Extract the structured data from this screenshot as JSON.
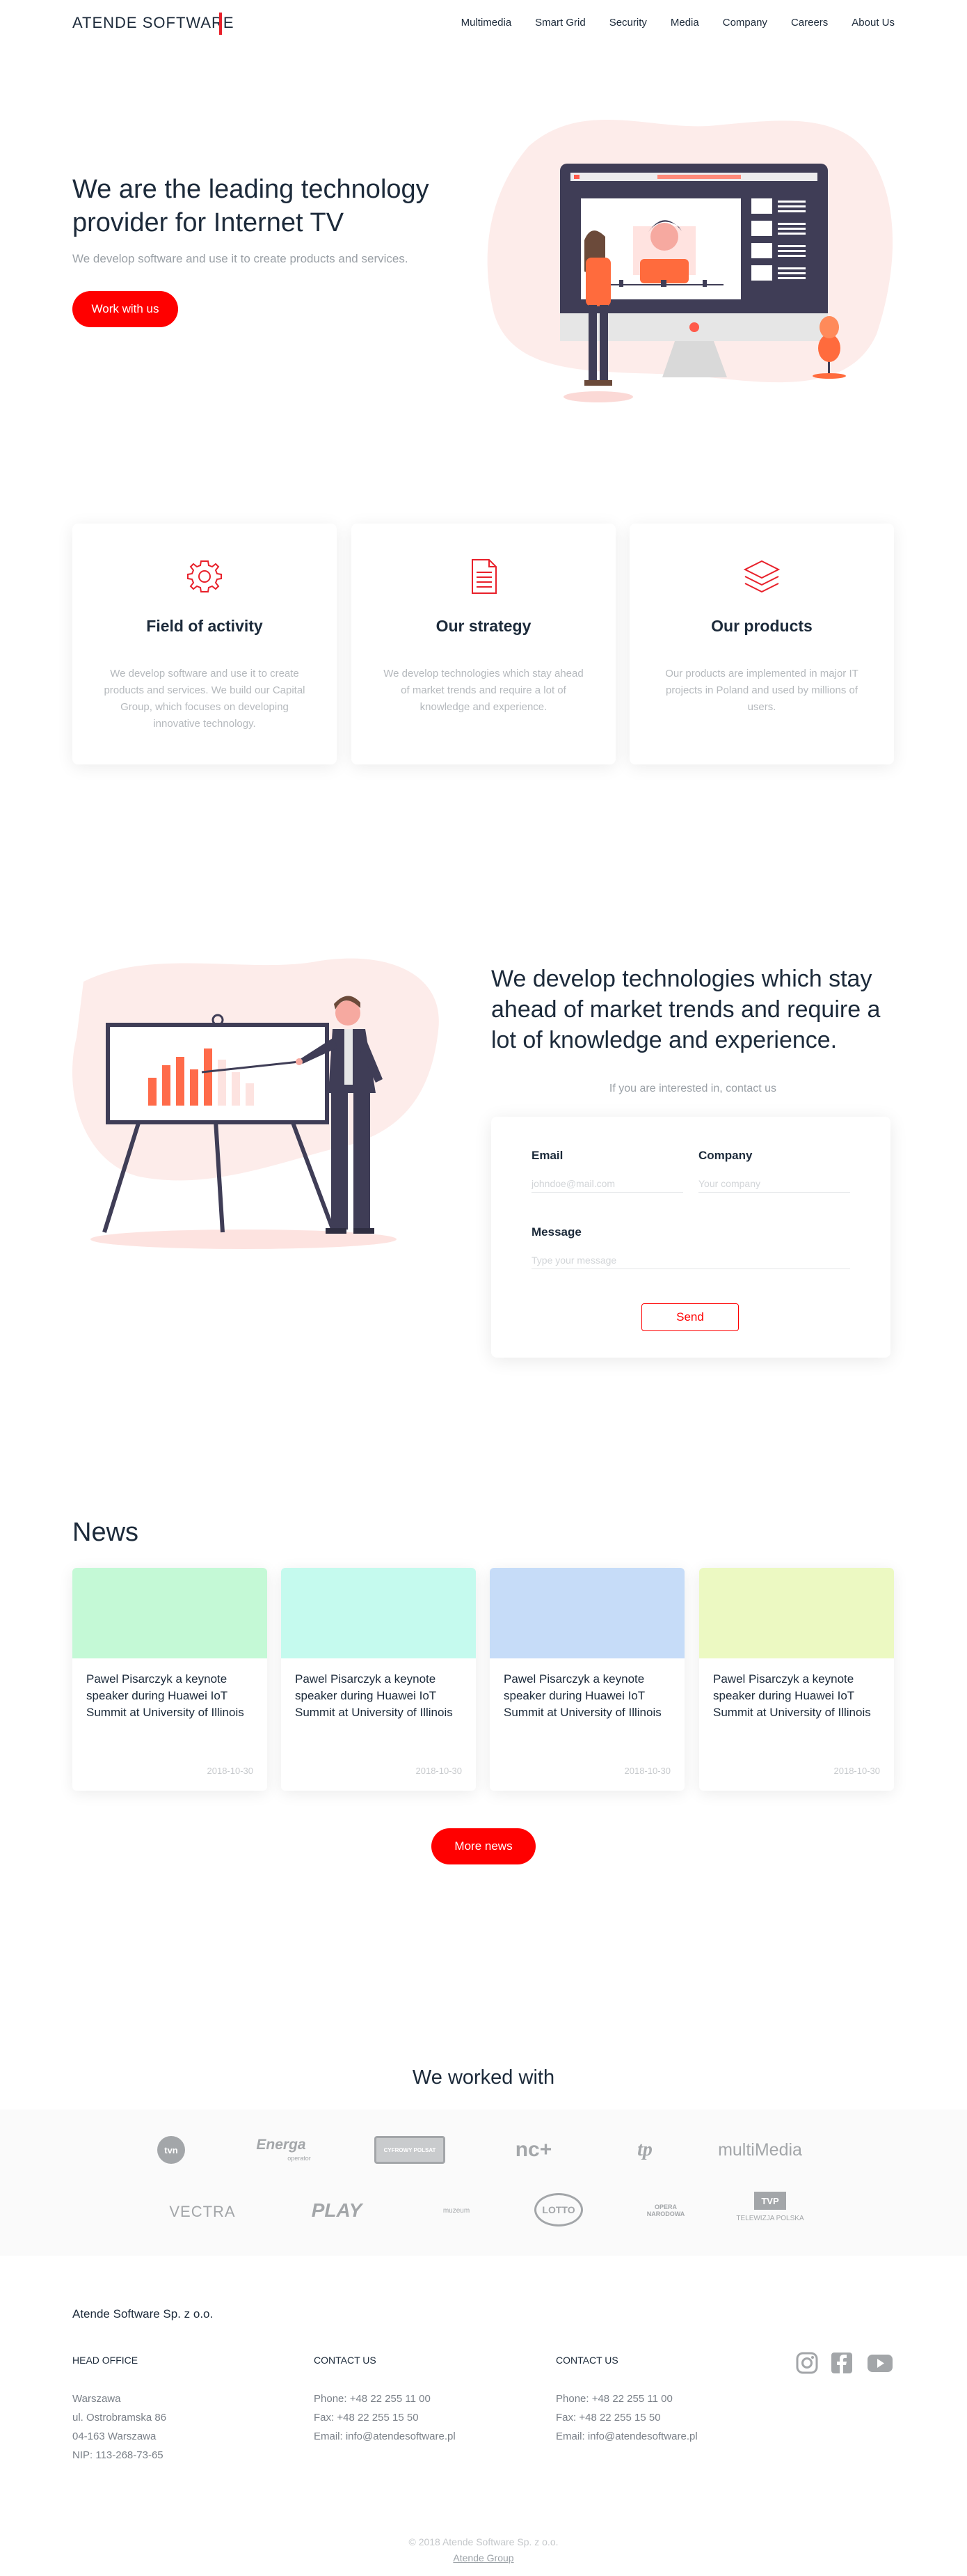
{
  "header": {
    "logo": "ATENDE SOFTWARE",
    "nav": [
      "Multimedia",
      "Smart Grid",
      "Security",
      "Media",
      "Company",
      "Careers",
      "About Us"
    ]
  },
  "hero": {
    "title": "We are the leading technology provider for Internet TV",
    "subtitle": "We develop software and use it to create products and services.",
    "button": "Work with us"
  },
  "features": [
    {
      "icon": "gear-icon",
      "title": "Field of activity",
      "text": "We develop software and use it to create products and services. We build our Capital Group, which focuses on developing innovative technology."
    },
    {
      "icon": "document-icon",
      "title": "Our strategy",
      "text": "We develop technologies which stay ahead of market trends and require a lot of knowledge and experience."
    },
    {
      "icon": "layers-icon",
      "title": "Our products",
      "text": "Our products are implemented in major IT projects in Poland and used by millions of users."
    }
  ],
  "tech": {
    "title": "We develop technologies which stay ahead of market trends and require a lot of knowledge and experience.",
    "subtitle": "If you are interested in, contact us",
    "form": {
      "email_label": "Email",
      "email_placeholder": "johndoe@mail.com",
      "company_label": "Company",
      "company_placeholder": "Your company",
      "message_label": "Message",
      "message_placeholder": "Type your message",
      "send": "Send"
    }
  },
  "news": {
    "title": "News",
    "items": [
      {
        "text": "Pawel Pisarczyk a keynote speaker during Huawei IoT Summit at University of Illinois",
        "date": "2018-10-30",
        "color": "#c4f9d6"
      },
      {
        "text": "Pawel Pisarczyk a keynote speaker during Huawei IoT Summit at University of Illinois",
        "date": "2018-10-30",
        "color": "#c5faee"
      },
      {
        "text": "Pawel Pisarczyk a keynote speaker during Huawei IoT Summit at University of Illinois",
        "date": "2018-10-30",
        "color": "#c6dcf8"
      },
      {
        "text": "Pawel Pisarczyk a keynote speaker during Huawei IoT Summit at University of Illinois",
        "date": "2018-10-30",
        "color": "#ecf9c2"
      }
    ],
    "more": "More news"
  },
  "partners": {
    "title": "We worked with",
    "row1": [
      "tvn",
      "Energa",
      "CYFROWY POLSAT",
      "nc+",
      "tp",
      "multiMedia"
    ],
    "row1_sub": {
      "energa": "operator"
    },
    "row2": [
      "VECTRA",
      "PLAY",
      "muzeum",
      "LOTTO",
      "OPERA NARODOWA",
      "TVP",
      "TELEWIZJA POLSKA"
    ]
  },
  "footer": {
    "company": "Atende Software Sp. z o.o.",
    "col1_head": "HEAD OFFICE",
    "col1": [
      "Warszawa",
      "ul. Ostrobramska 86",
      "04-163 Warszawa",
      "NIP: 113-268-73-65"
    ],
    "col2_head": "CONTACT US",
    "col2": [
      "Phone: +48 22 255 11 00",
      "Fax: +48 22 255 15 50",
      "Email: info@atendesoftware.pl"
    ],
    "col3_head": "CONTACT US",
    "col3": [
      "Phone: +48 22 255 11 00",
      "Fax: +48 22 255 15 50",
      "Email: info@atendesoftware.pl"
    ],
    "social": [
      "instagram-icon",
      "facebook-icon",
      "youtube-icon"
    ],
    "copyright": "© 2018 Atende Software Sp. z o.o.",
    "group_link": "Atende Group"
  },
  "colors": {
    "accent": "#ff0000",
    "text": "#1c2a3a",
    "muted": "#9aa0a6",
    "blob": "#fdecea"
  }
}
